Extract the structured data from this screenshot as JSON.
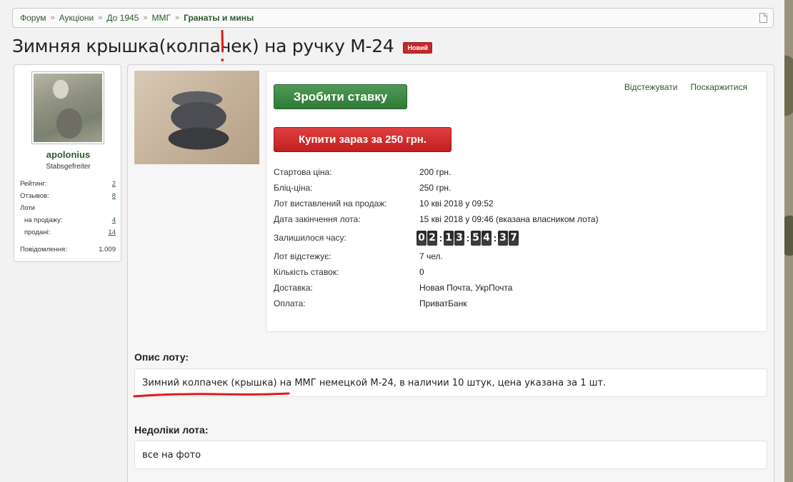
{
  "breadcrumb": {
    "items": [
      "Форум",
      "Аукціони",
      "До 1945",
      "ММГ"
    ],
    "current": "Гранаты и мины"
  },
  "title": "Зимняя крышка(колпачек) на ручку М-24",
  "badge": "Новий",
  "user": {
    "name": "apolonius",
    "rank": "Stabsgefreiter",
    "stats": {
      "rating_label": "Рейтинг:",
      "rating": "2",
      "reviews_label": "Отзывов:",
      "reviews": "8",
      "lots_label": "Лоти",
      "for_sale_label": "на продажу:",
      "for_sale": "4",
      "sold_label": "продані:",
      "sold": "14",
      "messages_label": "Повідомлення:",
      "messages": "1.009"
    }
  },
  "actions": {
    "bid": "Зробити ставку",
    "buy_now": "Купити зараз за 250 грн.",
    "watch": "Відстежувати",
    "report": "Поскаржитися"
  },
  "details": {
    "start_price_label": "Стартова ціна:",
    "start_price": "200 грн.",
    "blitz_label": "Бліц-ціна:",
    "blitz": "250 грн.",
    "listed_label": "Лот виставлений на продаж:",
    "listed": "10 кві 2018 у 09:52",
    "end_label": "Дата закінчення лота:",
    "end": "15 кві 2018 у 09:46 (вказана власником лота)",
    "remaining_label": "Залишилося часу:",
    "timer": {
      "d1": "0",
      "d2": "2",
      "h1": "1",
      "h2": "3",
      "m1": "5",
      "m2": "4",
      "s1": "3",
      "s2": "7"
    },
    "watchers_label": "Лот відстежує:",
    "watchers": "7 чел.",
    "bids_label": "Кількість ставок:",
    "bids": "0",
    "delivery_label": "Доставка:",
    "delivery": "Новая Почта, УкрПочта",
    "payment_label": "Оплата:",
    "payment": "ПриватБанк"
  },
  "description": {
    "title": "Опис лоту:",
    "text": "Зимний колпачек (крышка) на ММГ немецкой М-24, в наличии 10 штук, цена указана за 1 шт."
  },
  "defects": {
    "title": "Недоліки лота:",
    "text": "все на фото"
  },
  "colors": {
    "accent_green": "#2e5a2e",
    "bid_green": "#2f7a36",
    "buy_red": "#c11f21",
    "annotation_red": "#e11b1b"
  }
}
